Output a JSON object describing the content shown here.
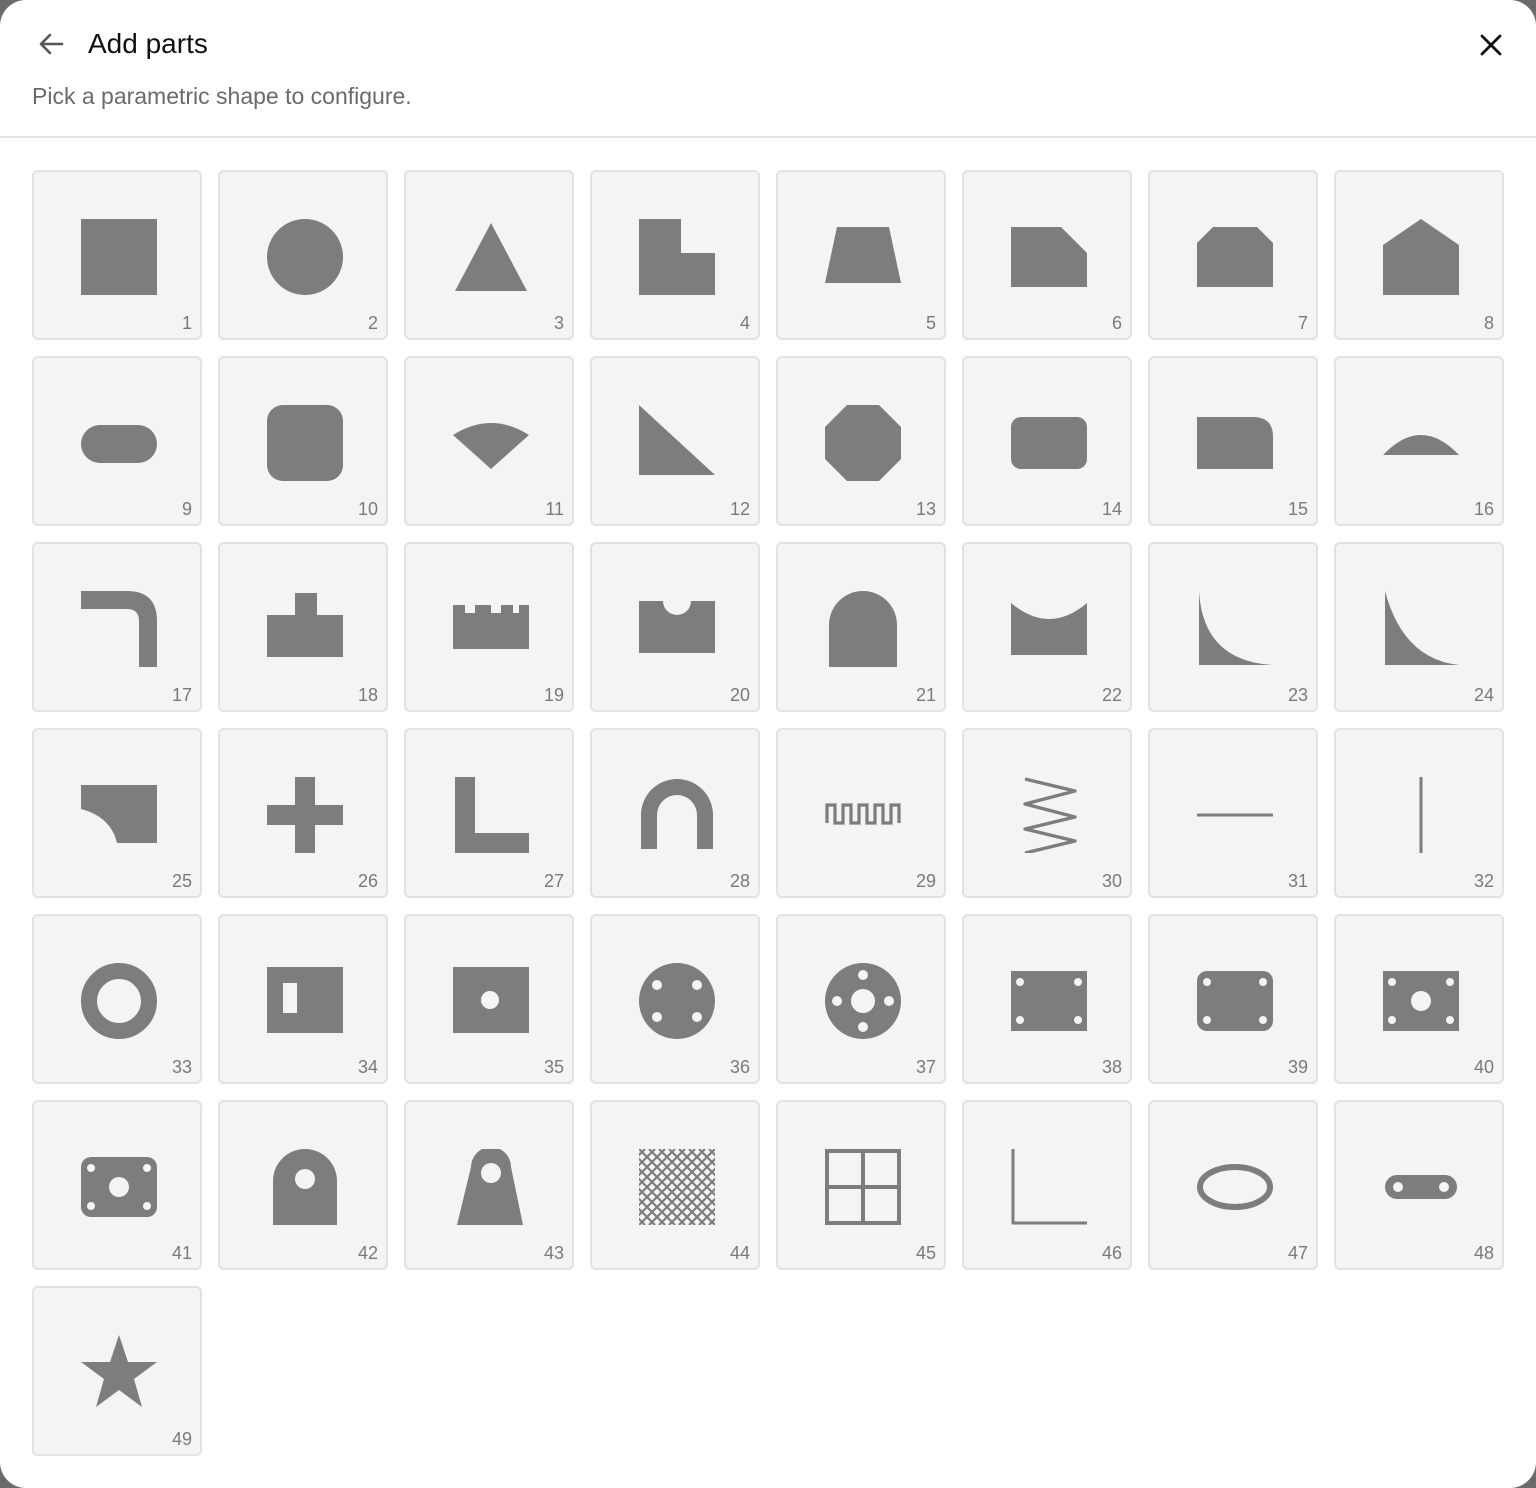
{
  "header": {
    "title": "Add parts",
    "subtitle": "Pick a parametric shape to configure."
  },
  "icons": {
    "back": "arrow-left-icon",
    "close": "close-icon"
  },
  "colors": {
    "shape_fill": "#7d7d7d",
    "tile_background": "#f4f4f4",
    "tile_border": "#e2e2e2"
  },
  "parts": [
    {
      "number": "1",
      "icon": "square-icon"
    },
    {
      "number": "2",
      "icon": "circle-icon"
    },
    {
      "number": "3",
      "icon": "triangle-icon"
    },
    {
      "number": "4",
      "icon": "l-bracket-icon"
    },
    {
      "number": "5",
      "icon": "trapezoid-icon"
    },
    {
      "number": "6",
      "icon": "chamfered-corner-icon"
    },
    {
      "number": "7",
      "icon": "chamfered-top-icon"
    },
    {
      "number": "8",
      "icon": "pentagon-house-icon"
    },
    {
      "number": "9",
      "icon": "slot-icon"
    },
    {
      "number": "10",
      "icon": "rounded-square-icon"
    },
    {
      "number": "11",
      "icon": "sector-icon"
    },
    {
      "number": "12",
      "icon": "right-triangle-icon"
    },
    {
      "number": "13",
      "icon": "octagon-icon"
    },
    {
      "number": "14",
      "icon": "rounded-rectangle-icon"
    },
    {
      "number": "15",
      "icon": "rounded-right-rectangle-icon"
    },
    {
      "number": "16",
      "icon": "circular-segment-icon"
    },
    {
      "number": "17",
      "icon": "bent-bar-icon"
    },
    {
      "number": "18",
      "icon": "tab-block-icon"
    },
    {
      "number": "19",
      "icon": "castellated-block-icon"
    },
    {
      "number": "20",
      "icon": "notched-block-icon"
    },
    {
      "number": "21",
      "icon": "arch-icon"
    },
    {
      "number": "22",
      "icon": "concave-top-block-icon"
    },
    {
      "number": "23",
      "icon": "concave-fillet-icon"
    },
    {
      "number": "24",
      "icon": "concave-spandrel-icon"
    },
    {
      "number": "25",
      "icon": "corner-cutout-plate-icon"
    },
    {
      "number": "26",
      "icon": "cross-icon"
    },
    {
      "number": "27",
      "icon": "angle-profile-icon"
    },
    {
      "number": "28",
      "icon": "u-bend-icon"
    },
    {
      "number": "29",
      "icon": "square-wave-icon"
    },
    {
      "number": "30",
      "icon": "zigzag-spring-icon"
    },
    {
      "number": "31",
      "icon": "horizontal-line-icon"
    },
    {
      "number": "32",
      "icon": "vertical-line-icon"
    },
    {
      "number": "33",
      "icon": "ring-icon"
    },
    {
      "number": "34",
      "icon": "slotted-plate-icon"
    },
    {
      "number": "35",
      "icon": "plate-center-hole-icon"
    },
    {
      "number": "36",
      "icon": "disc-four-holes-icon"
    },
    {
      "number": "37",
      "icon": "flange-icon"
    },
    {
      "number": "38",
      "icon": "plate-four-holes-icon"
    },
    {
      "number": "39",
      "icon": "rounded-plate-four-holes-icon"
    },
    {
      "number": "40",
      "icon": "plate-five-holes-icon"
    },
    {
      "number": "41",
      "icon": "rounded-plate-five-holes-icon"
    },
    {
      "number": "42",
      "icon": "arched-lug-icon"
    },
    {
      "number": "43",
      "icon": "tapered-lug-icon"
    },
    {
      "number": "44",
      "icon": "mesh-icon"
    },
    {
      "number": "45",
      "icon": "window-grid-icon"
    },
    {
      "number": "46",
      "icon": "angle-line-icon"
    },
    {
      "number": "47",
      "icon": "ellipse-ring-icon"
    },
    {
      "number": "48",
      "icon": "link-bar-icon"
    },
    {
      "number": "49",
      "icon": "star-icon"
    }
  ]
}
